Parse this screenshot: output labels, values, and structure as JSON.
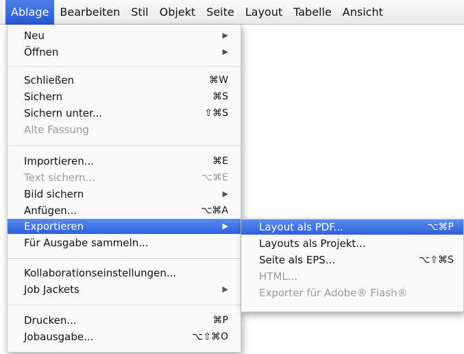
{
  "menubar": {
    "items": [
      "Ablage",
      "Bearbeiten",
      "Stil",
      "Objekt",
      "Seite",
      "Layout",
      "Tabelle",
      "Ansicht"
    ]
  },
  "menu": {
    "neu": {
      "label": "Neu"
    },
    "oeffnen": {
      "label": "Öffnen"
    },
    "schliessen": {
      "label": "Schließen",
      "shortcut": "⌘W"
    },
    "sichern": {
      "label": "Sichern",
      "shortcut": "⌘S"
    },
    "sichern_unter": {
      "label": "Sichern unter...",
      "shortcut": "⇧⌘S"
    },
    "alte_fassung": {
      "label": "Alte Fassung"
    },
    "importieren": {
      "label": "Importieren...",
      "shortcut": "⌘E"
    },
    "text_sichern": {
      "label": "Text sichern...",
      "shortcut": "⌥⌘E"
    },
    "bild_sichern": {
      "label": "Bild sichern"
    },
    "anfuegen": {
      "label": "Anfügen...",
      "shortcut": "⌥⌘A"
    },
    "exportieren": {
      "label": "Exportieren"
    },
    "ausgabe_sammeln": {
      "label": "Für Ausgabe sammeln..."
    },
    "kollaboration": {
      "label": "Kollaborationseinstellungen..."
    },
    "job_jackets": {
      "label": "Job Jackets"
    },
    "drucken": {
      "label": "Drucken...",
      "shortcut": "⌘P"
    },
    "jobausgabe": {
      "label": "Jobausgabe...",
      "shortcut": "⌥⇧⌘O"
    }
  },
  "submenu": {
    "layout_pdf": {
      "label": "Layout als PDF...",
      "shortcut": "⌥⌘P"
    },
    "layouts_projekt": {
      "label": "Layouts als Projekt..."
    },
    "seite_eps": {
      "label": "Seite als EPS...",
      "shortcut": "⌥⇧⌘S"
    },
    "html": {
      "label": "HTML..."
    },
    "flash": {
      "label": "Exporter für Adobe® Flash®"
    }
  },
  "glyphs": {
    "submenu_arrow": "▶"
  },
  "colors": {
    "highlight": "#2d60da",
    "disabled_text": "#9a9a9a"
  }
}
